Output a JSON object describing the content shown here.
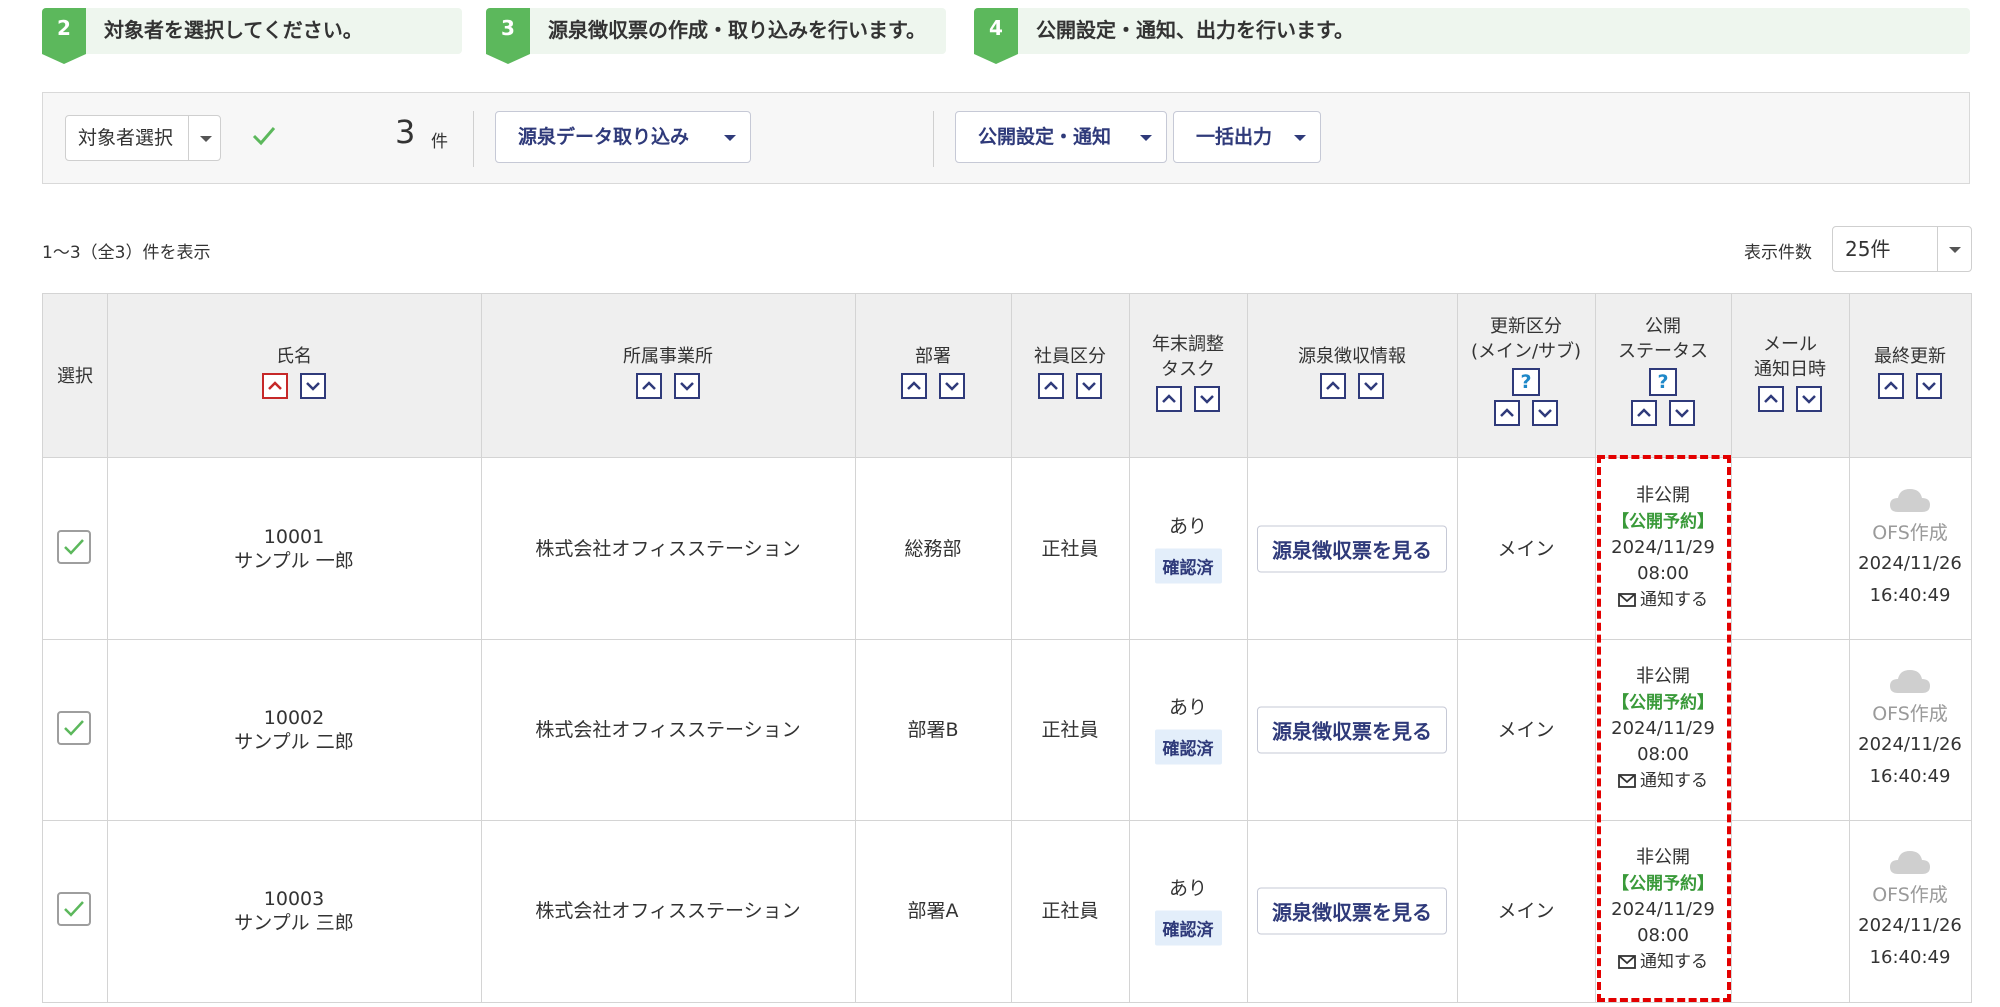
{
  "steps": [
    {
      "num": "2",
      "label": "対象者を選択してください。"
    },
    {
      "num": "3",
      "label": "源泉徴収票の作成・取り込みを行います。"
    },
    {
      "num": "4",
      "label": "公開設定・通知、出力を行います。"
    }
  ],
  "toolbar": {
    "target_select_label": "対象者選択",
    "selected_count": "3",
    "count_unit": "件",
    "import_label": "源泉データ取り込み",
    "publish_label": "公開設定・通知",
    "export_label": "一括出力"
  },
  "list_info": {
    "result_count": "1〜3（全3）件を表示",
    "per_page_label": "表示件数",
    "per_page_value": "25件"
  },
  "table": {
    "headers": {
      "select": "選択",
      "name": "氏名",
      "office": "所属事業所",
      "dept": "部署",
      "emp_type": "社員区分",
      "yearend_1": "年末調整",
      "yearend_2": "タスク",
      "withholding": "源泉徴収情報",
      "update_1": "更新区分",
      "update_2": "(メイン/サブ)",
      "status_1": "公開",
      "status_2": "ステータス",
      "mail_1": "メール",
      "mail_2": "通知日時",
      "last_update": "最終更新",
      "help": "?"
    },
    "rows": [
      {
        "code": "10001",
        "name": "サンプル 一郎",
        "office": "株式会社オフィスステーション",
        "dept": "総務部",
        "emp_type": "正社員",
        "task": "あり",
        "task_badge": "確認済",
        "view_button": "源泉徴収票を見る",
        "update_type": "メイン",
        "status": "非公開",
        "scheduled": "【公開予約】",
        "sched_date": "2024/11/29",
        "sched_time": "08:00",
        "notify": "通知する",
        "source": "OFS作成",
        "upd_date": "2024/11/26",
        "upd_time": "16:40:49"
      },
      {
        "code": "10002",
        "name": "サンプル 二郎",
        "office": "株式会社オフィスステーション",
        "dept": "部署B",
        "emp_type": "正社員",
        "task": "あり",
        "task_badge": "確認済",
        "view_button": "源泉徴収票を見る",
        "update_type": "メイン",
        "status": "非公開",
        "scheduled": "【公開予約】",
        "sched_date": "2024/11/29",
        "sched_time": "08:00",
        "notify": "通知する",
        "source": "OFS作成",
        "upd_date": "2024/11/26",
        "upd_time": "16:40:49"
      },
      {
        "code": "10003",
        "name": "サンプル 三郎",
        "office": "株式会社オフィスステーション",
        "dept": "部署A",
        "emp_type": "正社員",
        "task": "あり",
        "task_badge": "確認済",
        "view_button": "源泉徴収票を見る",
        "update_type": "メイン",
        "status": "非公開",
        "scheduled": "【公開予約】",
        "sched_date": "2024/11/29",
        "sched_time": "08:00",
        "notify": "通知する",
        "source": "OFS作成",
        "upd_date": "2024/11/26",
        "upd_time": "16:40:49"
      }
    ]
  },
  "colors": {
    "step_green": "#5cb85c",
    "accent_navy": "#2f3a7a",
    "scheduled_green": "#3a9a3a",
    "highlight_red": "#e30000"
  }
}
